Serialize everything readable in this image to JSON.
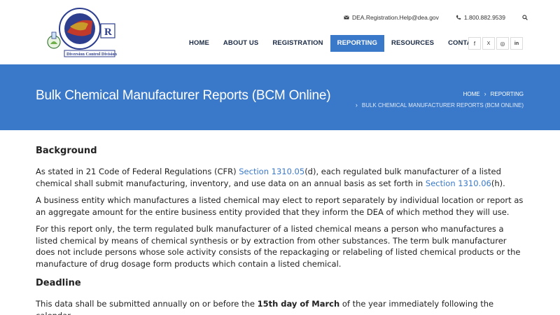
{
  "header": {
    "logo_text": "U.S. Department of Justice Drug Enforcement Administration",
    "logo_caption": "Diversion Control Division",
    "email": "DEA.Registration.Help@dea.gov",
    "phone": "1.800.882.9539"
  },
  "nav": {
    "items": [
      {
        "label": "HOME"
      },
      {
        "label": "ABOUT US"
      },
      {
        "label": "REGISTRATION"
      },
      {
        "label": "REPORTING"
      },
      {
        "label": "RESOURCES"
      },
      {
        "label": "CONTACT US"
      }
    ],
    "active_index": 3
  },
  "social": {
    "facebook": "f",
    "x": "X",
    "instagram": "◎",
    "linkedin": "in"
  },
  "banner": {
    "title": "Bulk Chemical Manufacturer Reports (BCM Online)",
    "breadcrumb": {
      "home": "HOME",
      "reporting": "REPORTING",
      "current": "BULK CHEMICAL MANUFACTURER REPORTS (BCM ONLINE)"
    }
  },
  "content": {
    "background_heading": "Background",
    "p1_a": "As stated in 21 Code of Federal Regulations (CFR) ",
    "p1_link1": "Section 1310.05",
    "p1_b": "(d), each regulated bulk manufacturer of a listed chemical shall submit manufacturing, inventory, and use data on an annual basis as set forth in ",
    "p1_link2": "Section 1310.06",
    "p1_c": "(h).",
    "p2": "A business entity which manufactures a listed chemical may elect to report separately by individual location or report as an aggregate amount for the entire business entity provided that they inform the DEA of which method they will use.",
    "p3": "For this report only, the term regulated bulk manufacturer of a listed chemical means a person who manufactures a listed chemical by means of chemical synthesis or by extraction from other substances. The term bulk manufacturer does not include persons whose sole activity consists of the repackaging or relabeling of listed chemical products or the manufacture of drug dosage form products which contain a listed chemical.",
    "deadline_heading": "Deadline",
    "p4_a": "This data shall be submitted annually on or before the ",
    "p4_bold": "15th day of March",
    "p4_b": " of the year immediately following the calendar"
  },
  "colors": {
    "brand_blue": "#3a79c9",
    "nav_text": "#1a2a44"
  }
}
